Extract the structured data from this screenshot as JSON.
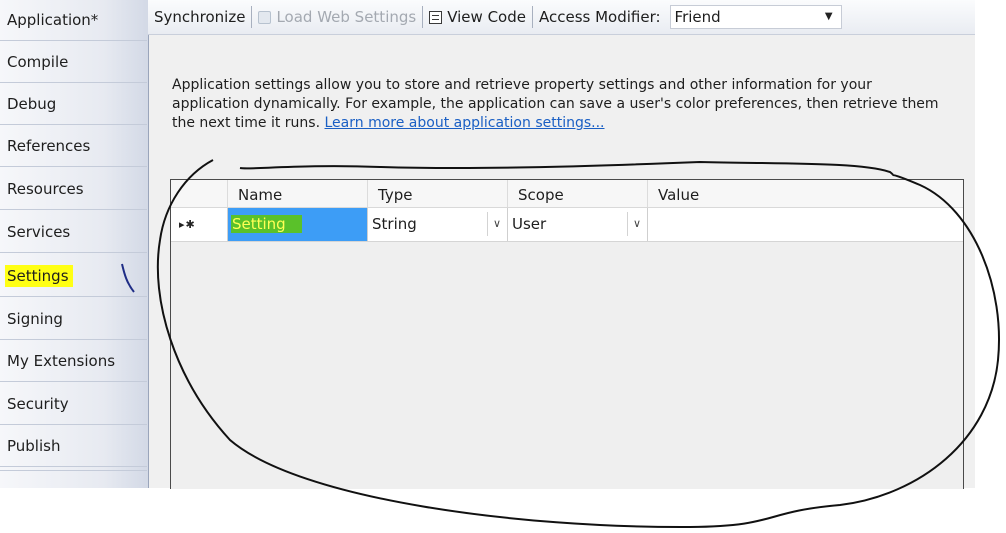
{
  "sidebar": {
    "tabs": [
      {
        "label": "Application*"
      },
      {
        "label": "Compile"
      },
      {
        "label": "Debug"
      },
      {
        "label": "References"
      },
      {
        "label": "Resources"
      },
      {
        "label": "Services"
      },
      {
        "label": "Settings"
      },
      {
        "label": "Signing"
      },
      {
        "label": "My Extensions"
      },
      {
        "label": "Security"
      },
      {
        "label": "Publish"
      }
    ],
    "selected": "Settings"
  },
  "toolbar": {
    "synchronize": "Synchronize",
    "load_web_settings": "Load Web Settings",
    "view_code": "View Code",
    "access_modifier_label": "Access Modifier:",
    "access_modifier_value": "Friend"
  },
  "description": {
    "text": "Application settings allow you to store and retrieve property settings and other information for your application dynamically. For example, the application can save a user's color preferences, then retrieve them the next time it runs.",
    "link": "Learn more about application settings..."
  },
  "grid": {
    "columns": [
      "Name",
      "Type",
      "Scope",
      "Value"
    ],
    "rows": [
      {
        "marker": "▸✱",
        "name": "Setting",
        "type": "String",
        "scope": "User",
        "value": ""
      }
    ]
  },
  "colors": {
    "selection_blue": "#3d9df6",
    "highlight_yellow": "#ffff14",
    "highlight_green": "#5ac12a",
    "link_blue": "#1a5fc4"
  }
}
